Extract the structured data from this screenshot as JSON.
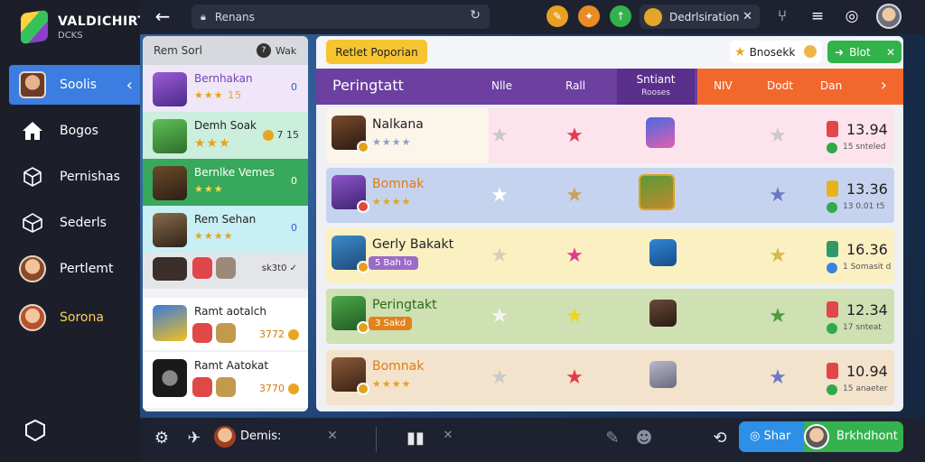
{
  "brand": {
    "name": "VALDICHIRT",
    "sub": "DCKS"
  },
  "sidebar": {
    "items": [
      {
        "label": "Soolis",
        "icon": "avatar-icon",
        "active": true
      },
      {
        "label": "Bogos",
        "icon": "home-icon"
      },
      {
        "label": "Pernishas",
        "icon": "cube-icon"
      },
      {
        "label": "Sederls",
        "icon": "box-icon"
      },
      {
        "label": "Pertlemt",
        "icon": "avatar-icon"
      },
      {
        "label": "Sorona",
        "icon": "avatar-icon"
      }
    ]
  },
  "topbar": {
    "address": "Renans",
    "tab_label": "Dedrlsiration",
    "tab_close": "✕"
  },
  "midpanel": {
    "header": "Rem Sorl",
    "header_badge": "?",
    "header_right": "Wak",
    "rows": [
      {
        "name": "Bernhakan",
        "stars": "★★★ 15",
        "meta": "0"
      },
      {
        "name": "Demh Soak",
        "stars": "★★★",
        "meta": "7 15"
      },
      {
        "name": "Bernlke Vemes",
        "stars": "★★★",
        "meta": "0"
      },
      {
        "name": "Rem Sehan",
        "stars": "★★★★",
        "meta": "0"
      },
      {
        "name": "",
        "stars": "",
        "meta": "sk3t0 ✓"
      },
      {
        "name": "Ramt aotalch",
        "stars": "",
        "meta": "3772"
      },
      {
        "name": "Ramt Aatokat",
        "stars": "",
        "meta": "3770"
      }
    ]
  },
  "mainpanel": {
    "yellow_button": "Retlet Poporian",
    "bonus_label": "Bnosekk",
    "green_button": "Blot",
    "green_close": "✕",
    "title": "Peringtatt",
    "tabs": [
      "Nlle",
      "Rall"
    ],
    "selected_tab": {
      "label": "Sntiant",
      "sub": "Rooses"
    },
    "orange_tabs": [
      "NIV",
      "Dodt",
      "Dan"
    ],
    "rows": [
      {
        "name": "Nalkana",
        "sub": "★★★★",
        "score": "13.94",
        "sub2": "15 snteled"
      },
      {
        "name": "Bomnak",
        "sub": "★★★★",
        "score": "13.36",
        "sub2": "13 0.01 t5"
      },
      {
        "name": "Gerly Bakakt",
        "badge": "5 Bah lo",
        "score": "16.36",
        "sub2": "1 Somasit d"
      },
      {
        "name": "Peringtakt",
        "badge": "3 Sakd",
        "score": "12.34",
        "sub2": "17 snteat"
      },
      {
        "name": "Bomnak",
        "sub": "★★★★",
        "score": "10.94",
        "sub2": "15 anaeter"
      }
    ]
  },
  "bottombar": {
    "label": "Demis:",
    "share_label": "Shar",
    "green_label": "Brkhdhont"
  }
}
